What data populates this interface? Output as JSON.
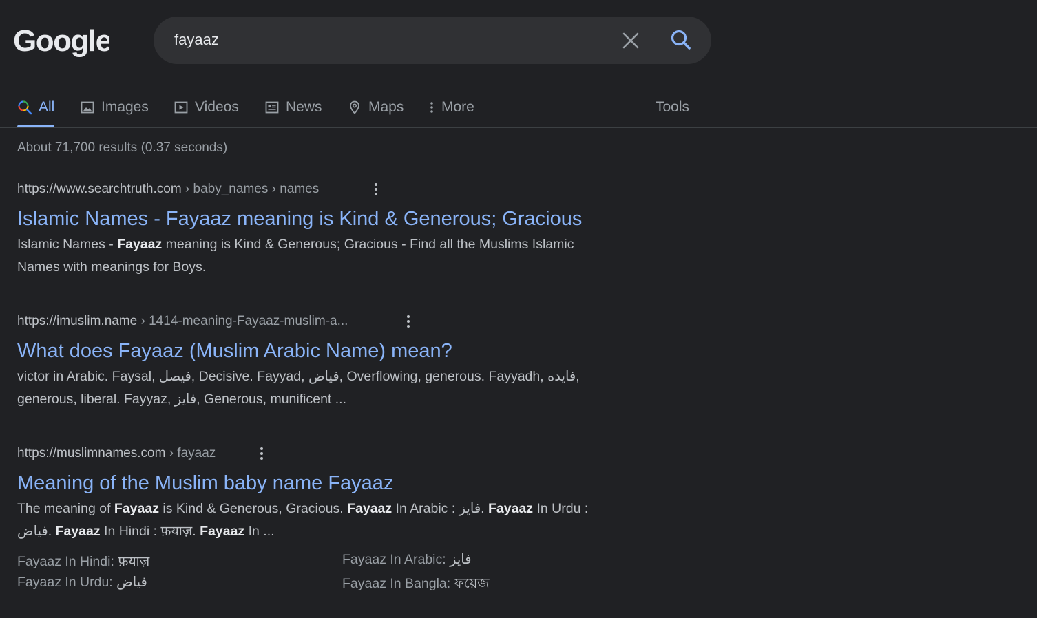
{
  "logo": {
    "text": "Google"
  },
  "search": {
    "query": "fayaaz",
    "clear_icon": "close-icon",
    "search_icon": "search-icon"
  },
  "tabs": [
    {
      "label": "All",
      "icon": "search-icon",
      "active": true
    },
    {
      "label": "Images",
      "icon": "image-icon"
    },
    {
      "label": "Videos",
      "icon": "video-icon"
    },
    {
      "label": "News",
      "icon": "news-icon"
    },
    {
      "label": "Maps",
      "icon": "map-pin-icon"
    },
    {
      "label": "More",
      "icon": "more-vert-icon"
    }
  ],
  "tools_label": "Tools",
  "stats": "About 71,700 results (0.37 seconds)",
  "results": [
    {
      "site": "https://www.searchtruth.com",
      "path": " › baby_names › names",
      "title": "Islamic Names - Fayaaz meaning is Kind & Generous; Gracious",
      "snippet_lines": [
        [
          "Islamic Names - ",
          "Fayaaz",
          " meaning is Kind & Generous; Gracious - Find all the Muslims Islamic"
        ],
        [
          "Names with meanings for Boys."
        ]
      ]
    },
    {
      "site": "https://imuslim.name",
      "path": " › 1414-meaning-Fayaaz-muslim-a...",
      "title": "What does Fayaaz (Muslim Arabic Name) mean?",
      "snippet_lines": [
        [
          "victor in Arabic. Faysal, فيصل, Decisive. Fayyad, فياض, Overflowing, generous. Fayyadh, فايده,"
        ],
        [
          "generous, liberal. Fayyaz, فايز, Generous, munificent ..."
        ]
      ]
    },
    {
      "site": "https://muslimnames.com",
      "path": " › fayaaz",
      "title": "Meaning of the Muslim baby name Fayaaz",
      "snippet_lines": [
        [
          "The meaning of ",
          "Fayaaz",
          " is Kind & Generous, Gracious. ",
          "Fayaaz",
          " In Arabic : فايز. ",
          "Fayaaz",
          " In Urdu :"
        ],
        [
          "فیاض. ",
          "Fayaaz",
          " In Hindi : फ़याज़. ",
          "Fayaaz",
          " In ..."
        ]
      ]
    }
  ],
  "facts": [
    {
      "label": "Fayaaz In Hindi: ",
      "value": "फ़याज़"
    },
    {
      "label": "Fayaaz In Arabic: ",
      "value": "فایز"
    },
    {
      "label": "Fayaaz In Urdu: ",
      "value": "فیاض"
    },
    {
      "label": "Fayaaz In Bangla: ",
      "value": "ফয়েজ"
    }
  ],
  "colors": {
    "background": "#202124",
    "link": "#8ab4f8",
    "text": "#bdc1c6",
    "muted": "#9aa0a6",
    "searchbox": "#303134"
  }
}
